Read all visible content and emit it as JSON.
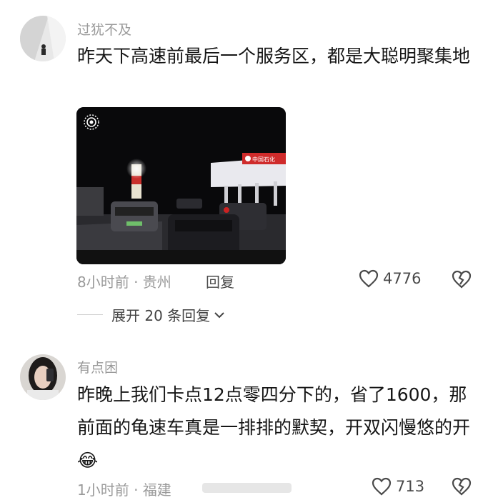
{
  "comments": [
    {
      "username": "过犹不及",
      "text": "昨天下高速前最后一个服务区，都是大聪明聚集地",
      "meta": "8小时前 · 贵州",
      "reply_label": "回复",
      "like_count": "4776",
      "expand_label": "展开 20 条回复"
    },
    {
      "username": "有点困",
      "text": "昨晚上我们卡点12点零四分下的，省了1600，那前面的龟速车真是一排排的默契，开双闪慢悠的开",
      "emoji": "😂",
      "meta": "1小时前 · 福建",
      "like_count": "713"
    }
  ],
  "photo": {
    "station_sign": "中国石化"
  },
  "icons": {
    "like": "heart-outline-icon",
    "dislike": "broken-heart-icon",
    "expand": "chevron-down-icon",
    "photo_badge": "live-photo-icon"
  }
}
